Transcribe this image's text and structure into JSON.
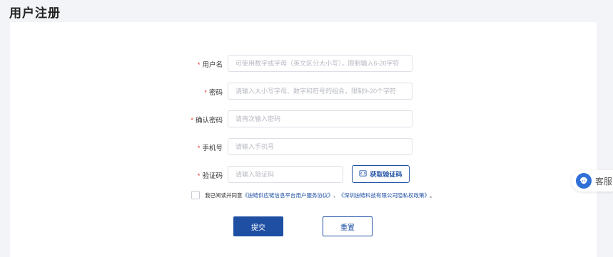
{
  "page": {
    "title": "用户注册"
  },
  "form": {
    "username": {
      "required_mark": "*",
      "label": "用户名",
      "placeholder": "可使用数字或字母（英文区分大小写），限制输入6-20字符"
    },
    "password": {
      "required_mark": "*",
      "label": "密码",
      "placeholder": "请输入大小写字母、数字和符号的组合，限制9-20个字符"
    },
    "confirm_password": {
      "required_mark": "*",
      "label": "确认密码",
      "placeholder": "请再次输入密码"
    },
    "phone": {
      "required_mark": "*",
      "label": "手机号",
      "placeholder": "请输入手机号"
    },
    "code": {
      "required_mark": "*",
      "label": "验证码",
      "placeholder": "请输入验证码",
      "button_label": "获取验证码"
    },
    "agreement": {
      "prefix": "我已阅读并同意",
      "link1": "《迪链供应链信息平台用户服务协议》",
      "separator": "、",
      "link2": "《深圳迪链科技有限公司隐私权政策》",
      "suffix": "。"
    },
    "submit_label": "提交",
    "reset_label": "重置"
  },
  "service": {
    "label": "客服"
  },
  "colors": {
    "primary": "#1e4fa3",
    "required": "#e53935",
    "background": "#f3f4f7"
  }
}
